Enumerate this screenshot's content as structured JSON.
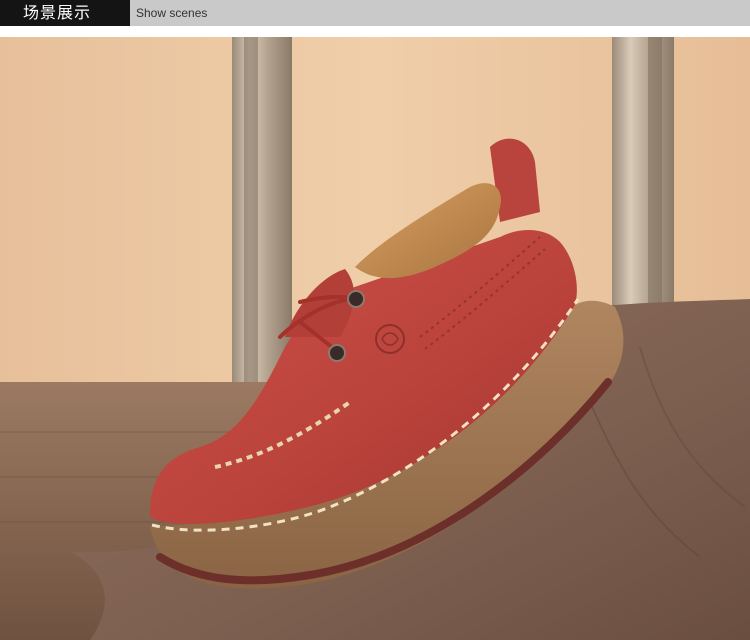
{
  "header": {
    "title_cn": "场景展示",
    "title_en": "Show scenes"
  },
  "colors": {
    "header_black": "#141414",
    "header_gray": "#c9c9c9",
    "wall": "#e9c6a0",
    "floor_wood": "#8a6a55",
    "leather_cloth": "#8a6a5a",
    "shoe_leather": "#c2463f",
    "sole": "#a0764f"
  },
  "scene": {
    "subject": "shoe"
  }
}
